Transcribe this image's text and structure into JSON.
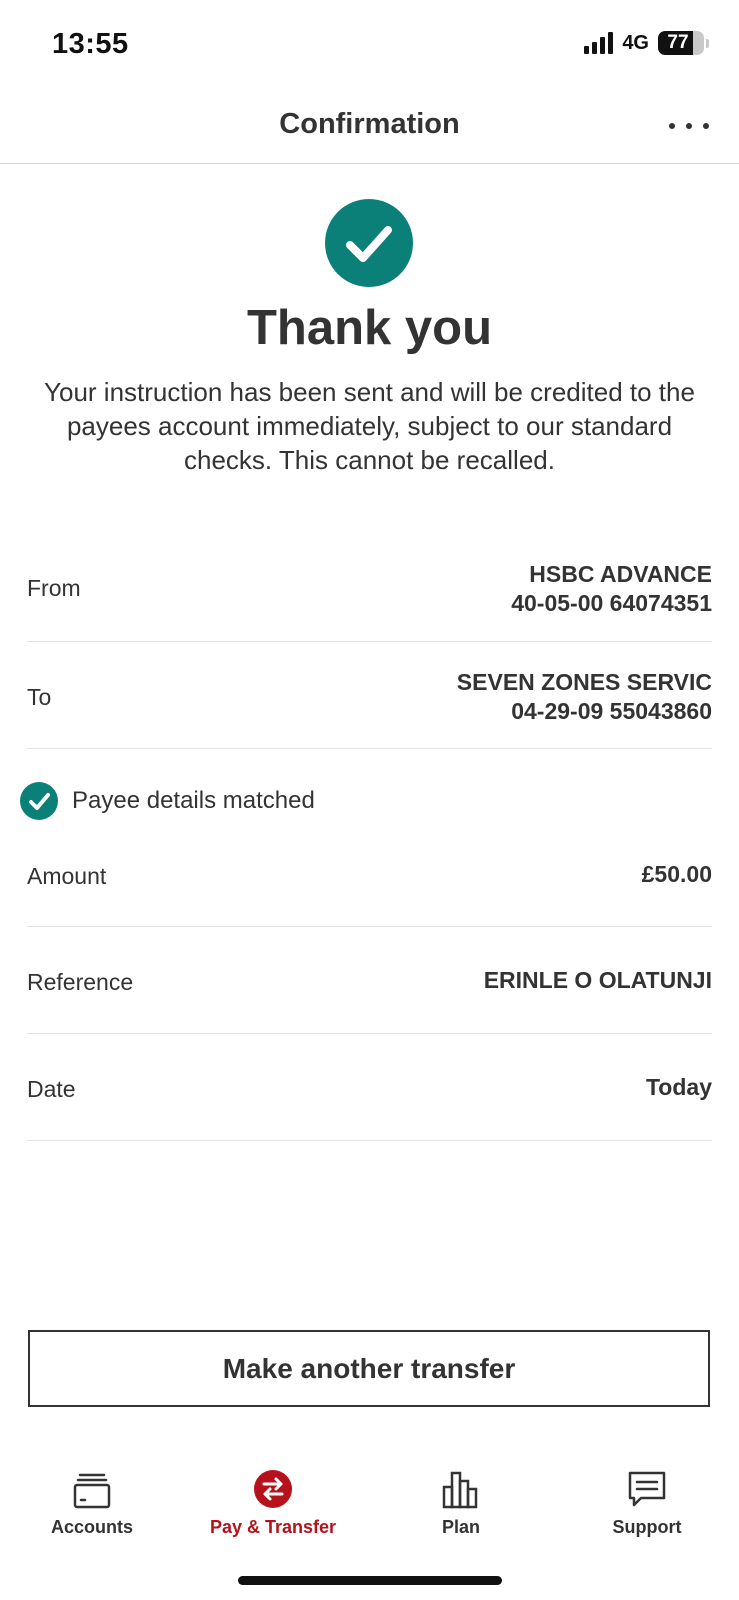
{
  "status_bar": {
    "time": "13:55",
    "network": "4G",
    "battery": "77",
    "battery_level_percent": 77
  },
  "header": {
    "title": "Confirmation",
    "more_icon": "more-horizontal-icon"
  },
  "confirmation": {
    "icon": "check-circle-icon",
    "title": "Thank you",
    "message": "Your instruction has been sent and will be credited to the payees account immediately, subject to our standard checks.  This cannot be recalled."
  },
  "details": {
    "from": {
      "label": "From",
      "name": "HSBC ADVANCE",
      "account": "40-05-00 64074351"
    },
    "to": {
      "label": "To",
      "name": "SEVEN ZONES SERVIC",
      "account": "04-29-09 55043860"
    },
    "payee_match": {
      "icon": "check-circle-icon",
      "text": "Payee details matched"
    },
    "amount": {
      "label": "Amount",
      "value": "£50.00"
    },
    "reference": {
      "label": "Reference",
      "value": "ERINLE O OLATUNJI"
    },
    "date": {
      "label": "Date",
      "value": "Today"
    }
  },
  "actions": {
    "make_another": "Make another transfer"
  },
  "tab_bar": {
    "accent_color": "#b5121b",
    "tabs": [
      {
        "label": "Accounts",
        "icon": "wallet-icon",
        "active": false
      },
      {
        "label": "Pay & Transfer",
        "icon": "transfer-arrows-icon",
        "active": true
      },
      {
        "label": "Plan",
        "icon": "bar-chart-icon",
        "active": false
      },
      {
        "label": "Support",
        "icon": "chat-bubble-icon",
        "active": false
      }
    ]
  },
  "colors": {
    "success": "#0a8078",
    "text": "#333333",
    "divider": "#e2e2e2"
  }
}
